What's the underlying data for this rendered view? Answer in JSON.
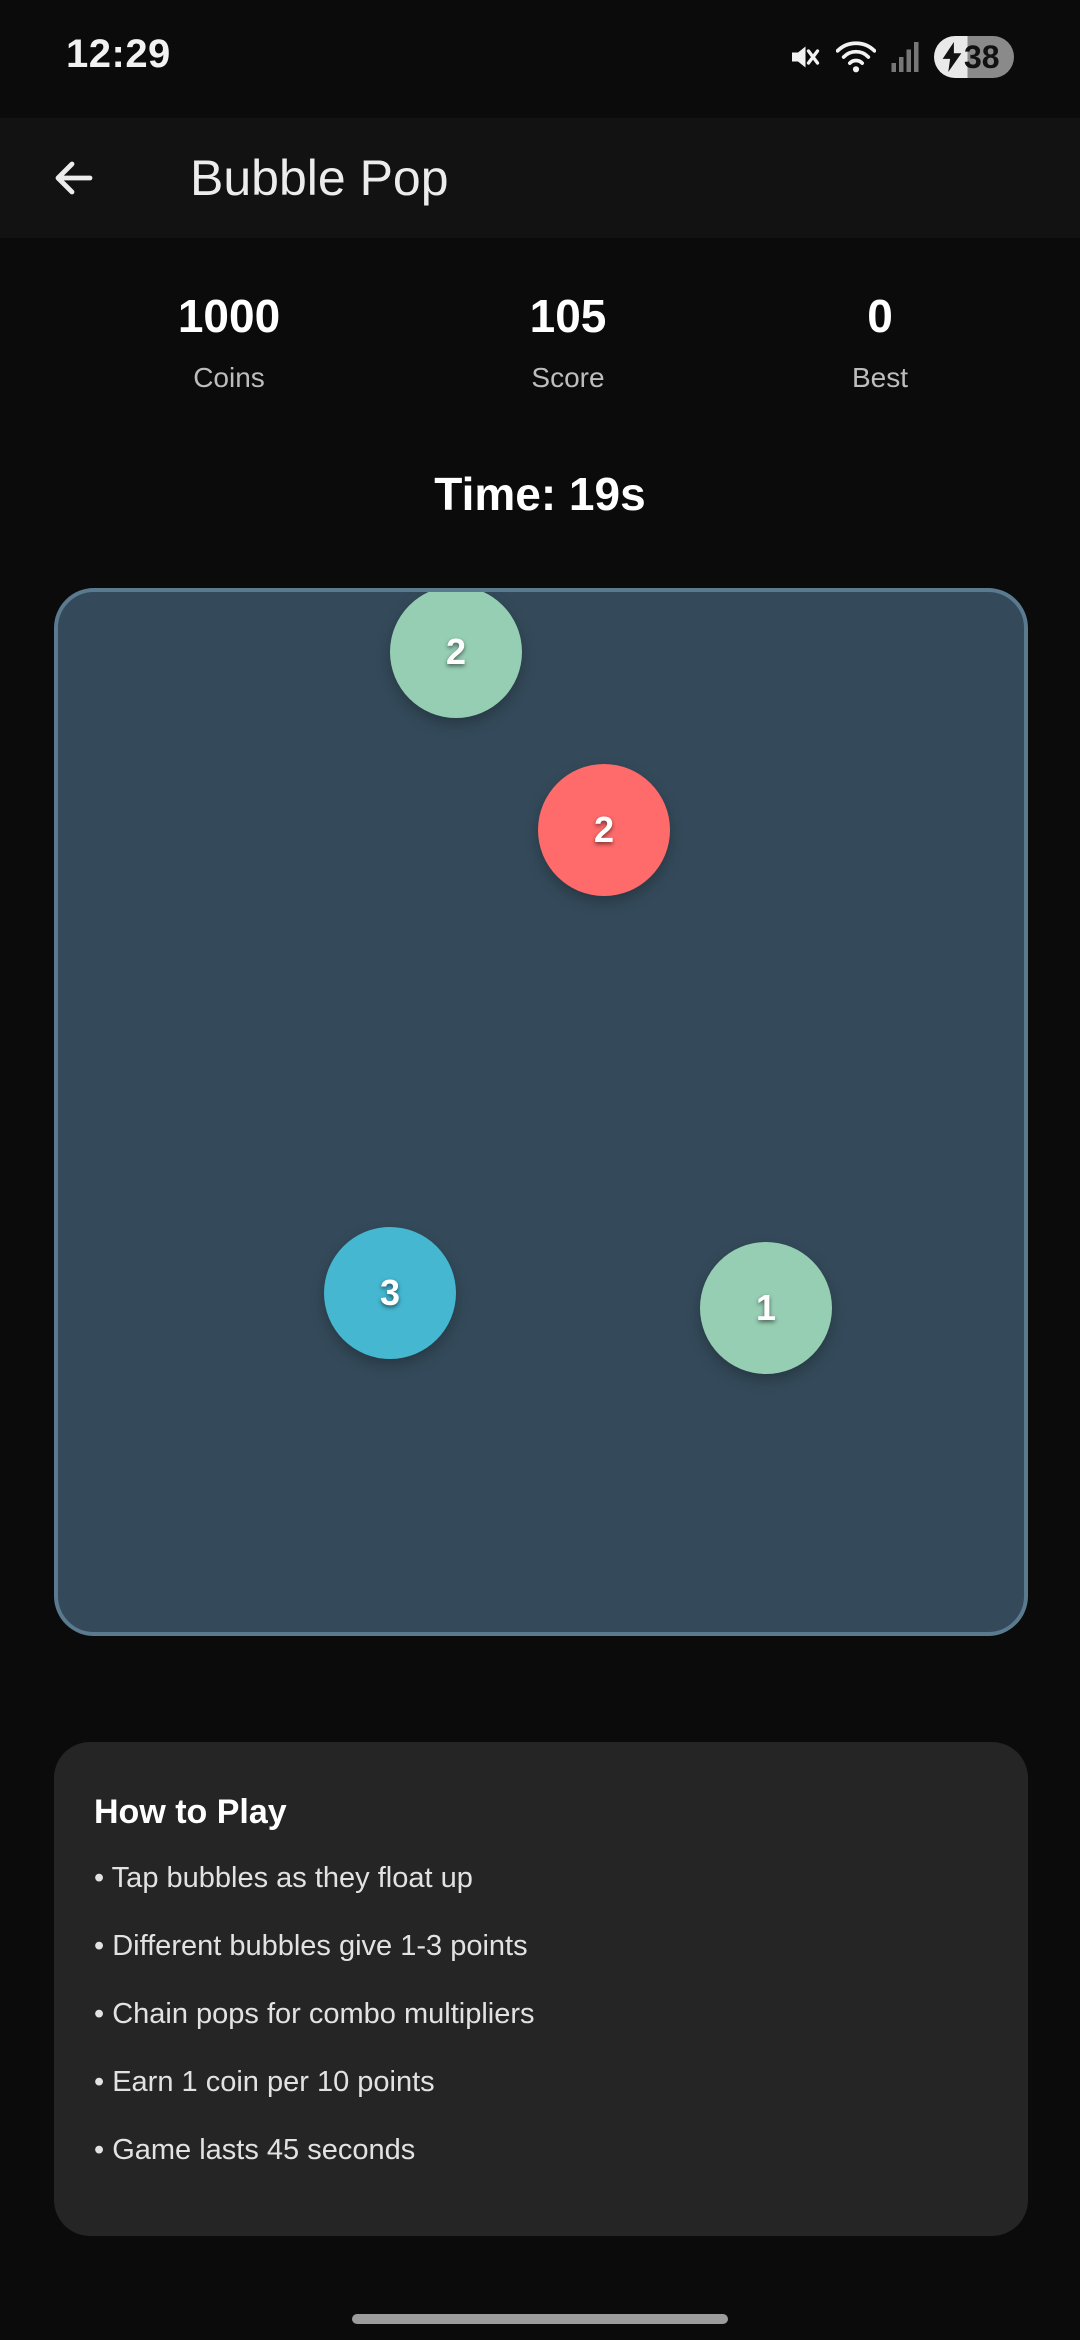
{
  "status_bar": {
    "time": "12:29",
    "battery": "38"
  },
  "app_bar": {
    "title": "Bubble Pop"
  },
  "stats": [
    {
      "value": "1000",
      "label": "Coins"
    },
    {
      "value": "105",
      "label": "Score"
    },
    {
      "value": "0",
      "label": "Best"
    }
  ],
  "timer": "Time: 19s",
  "bubbles": [
    {
      "points": "2",
      "color": "#96ceb4"
    },
    {
      "points": "2",
      "color": "#ff6b6b"
    },
    {
      "points": "3",
      "color": "#45b7d1"
    },
    {
      "points": "1",
      "color": "#96ceb4"
    }
  ],
  "instructions": {
    "title": "How to Play",
    "items": [
      "• Tap bubbles as they float up",
      "• Different bubbles give 1-3 points",
      "• Chain pops for combo multipliers",
      "• Earn 1 coin per 10 points",
      "• Game lasts 45 seconds"
    ]
  },
  "colors": {
    "game_area": "#344a5a",
    "card": "#252525",
    "background": "#0b0b0b"
  }
}
